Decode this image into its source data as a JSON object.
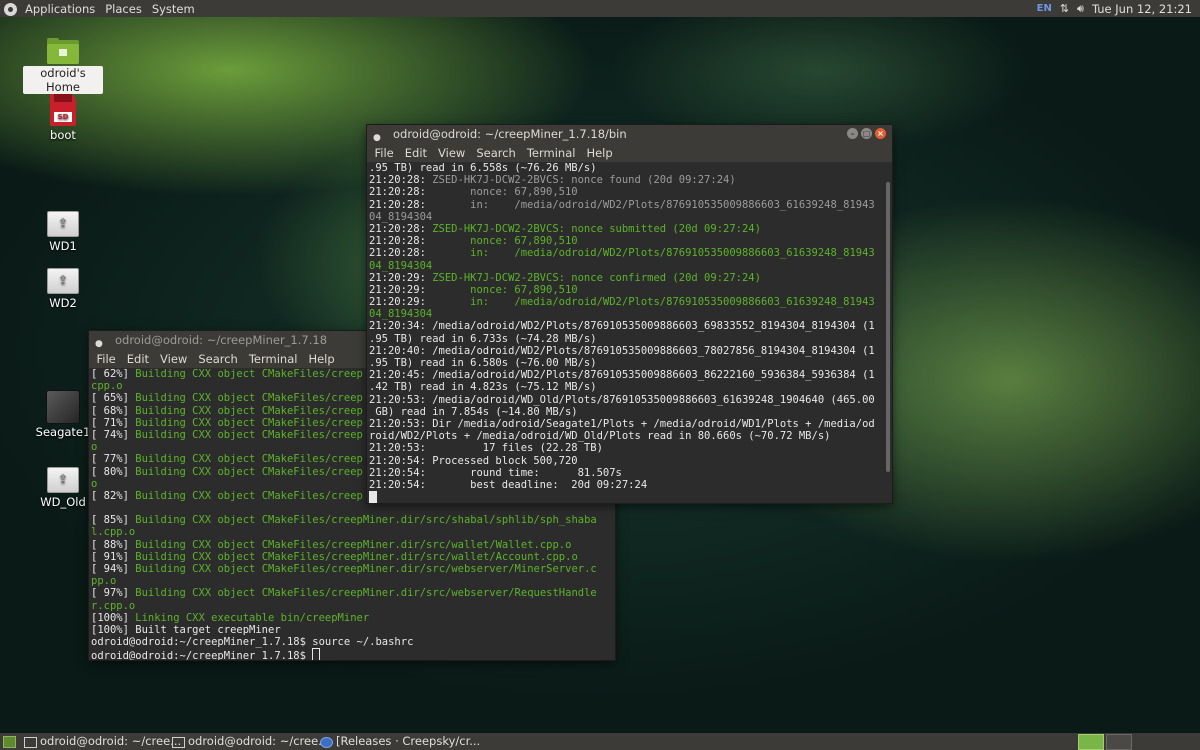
{
  "top_panel": {
    "menus": [
      "Applications",
      "Places",
      "System"
    ],
    "keyboard_indicator": "EN",
    "network_icon": "network-arrows-icon",
    "volume_icon": "speaker-icon",
    "clock": "Tue Jun 12, 21:21"
  },
  "desktop": {
    "icons": [
      {
        "label": "odroid's Home",
        "icon": "home-folder-icon"
      },
      {
        "label": "boot",
        "icon": "sd-card-icon"
      },
      {
        "label": "WD1",
        "icon": "usb-drive-icon"
      },
      {
        "label": "WD2",
        "icon": "usb-drive-icon"
      },
      {
        "label": "Seagate1",
        "icon": "hard-drive-icon"
      },
      {
        "label": "WD_Old",
        "icon": "usb-drive-icon"
      }
    ]
  },
  "terminal_build": {
    "title": "odroid@odroid: ~/creepMiner_1.7.18",
    "menu": [
      "File",
      "Edit",
      "View",
      "Search",
      "Terminal",
      "Help"
    ],
    "lines": [
      [
        {
          "t": "[ 62%] ",
          "c": ""
        },
        {
          "t": "Building CXX object CMakeFiles/creep",
          "c": "g"
        }
      ],
      [
        {
          "t": "cpp.o",
          "c": "g"
        }
      ],
      [
        {
          "t": "[ 65%] ",
          "c": ""
        },
        {
          "t": "Building CXX object CMakeFiles/creep",
          "c": "g"
        }
      ],
      [
        {
          "t": "[ 68%] ",
          "c": ""
        },
        {
          "t": "Building CXX object CMakeFiles/creep",
          "c": "g"
        }
      ],
      [
        {
          "t": "[ 71%] ",
          "c": ""
        },
        {
          "t": "Building CXX object CMakeFiles/creep",
          "c": "g"
        }
      ],
      [
        {
          "t": "[ 74%] ",
          "c": ""
        },
        {
          "t": "Building CXX object CMakeFiles/creep",
          "c": "g"
        }
      ],
      [
        {
          "t": "o",
          "c": "g"
        }
      ],
      [
        {
          "t": "[ 77%] ",
          "c": ""
        },
        {
          "t": "Building CXX object CMakeFiles/creep",
          "c": "g"
        }
      ],
      [
        {
          "t": "[ 80%] ",
          "c": ""
        },
        {
          "t": "Building CXX object CMakeFiles/creep",
          "c": "g"
        }
      ],
      [
        {
          "t": "o",
          "c": "g"
        }
      ],
      [
        {
          "t": "[ 82%] ",
          "c": ""
        },
        {
          "t": "Building CXX object CMakeFiles/creep",
          "c": "g"
        }
      ],
      [
        {
          "t": "",
          "c": ""
        }
      ],
      [
        {
          "t": "[ 85%] ",
          "c": ""
        },
        {
          "t": "Building CXX object CMakeFiles/creepMiner.dir/src/shabal/sphlib/sph_shaba",
          "c": "g"
        }
      ],
      [
        {
          "t": "l.cpp.o",
          "c": "g"
        }
      ],
      [
        {
          "t": "[ 88%] ",
          "c": ""
        },
        {
          "t": "Building CXX object CMakeFiles/creepMiner.dir/src/wallet/Wallet.cpp.o",
          "c": "g"
        }
      ],
      [
        {
          "t": "[ 91%] ",
          "c": ""
        },
        {
          "t": "Building CXX object CMakeFiles/creepMiner.dir/src/wallet/Account.cpp.o",
          "c": "g"
        }
      ],
      [
        {
          "t": "[ 94%] ",
          "c": ""
        },
        {
          "t": "Building CXX object CMakeFiles/creepMiner.dir/src/webserver/MinerServer.c",
          "c": "g"
        }
      ],
      [
        {
          "t": "pp.o",
          "c": "g"
        }
      ],
      [
        {
          "t": "[ 97%] ",
          "c": ""
        },
        {
          "t": "Building CXX object CMakeFiles/creepMiner.dir/src/webserver/RequestHandle",
          "c": "g"
        }
      ],
      [
        {
          "t": "r.cpp.o",
          "c": "g"
        }
      ],
      [
        {
          "t": "[100%] ",
          "c": ""
        },
        {
          "t": "Linking CXX executable bin/creepMiner",
          "c": "g"
        }
      ],
      [
        {
          "t": "[100%] Built target creepMiner",
          "c": ""
        }
      ],
      [
        {
          "t": "odroid@odroid:~/creepMiner_1.7.18$ source ~/.bashrc",
          "c": ""
        }
      ],
      [
        {
          "t": "odroid@odroid:~/creepMiner_1.7.18$ ",
          "c": ""
        }
      ]
    ]
  },
  "terminal_miner": {
    "title": "odroid@odroid: ~/creepMiner_1.7.18/bin",
    "menu": [
      "File",
      "Edit",
      "View",
      "Search",
      "Terminal",
      "Help"
    ],
    "lines": [
      [
        {
          "t": ".95 TB) read in 6.558s (~76.26 MB/s)",
          "c": ""
        }
      ],
      [
        {
          "t": "21:20:28: ",
          "c": ""
        },
        {
          "t": "ZSED-HK7J-DCW2-2BVCS: nonce found (20d 09:27:24)",
          "c": "gy"
        }
      ],
      [
        {
          "t": "21:20:28:       ",
          "c": ""
        },
        {
          "t": "nonce: 67,890,510",
          "c": "gy"
        }
      ],
      [
        {
          "t": "21:20:28:       ",
          "c": ""
        },
        {
          "t": "in:    /media/odroid/WD2/Plots/876910535009886603_61639248_81943",
          "c": "gy"
        }
      ],
      [
        {
          "t": "04_8194304",
          "c": "gy"
        }
      ],
      [
        {
          "t": "21:20:28: ",
          "c": ""
        },
        {
          "t": "ZSED-HK7J-DCW2-2BVCS: nonce submitted (20d 09:27:24)",
          "c": "g"
        }
      ],
      [
        {
          "t": "21:20:28:       ",
          "c": ""
        },
        {
          "t": "nonce: 67,890,510",
          "c": "g"
        }
      ],
      [
        {
          "t": "21:20:28:       ",
          "c": ""
        },
        {
          "t": "in:    /media/odroid/WD2/Plots/876910535009886603_61639248_81943",
          "c": "g"
        }
      ],
      [
        {
          "t": "04_8194304",
          "c": "g"
        }
      ],
      [
        {
          "t": "21:20:29: ",
          "c": ""
        },
        {
          "t": "ZSED-HK7J-DCW2-2BVCS: nonce confirmed (20d 09:27:24)",
          "c": "g"
        }
      ],
      [
        {
          "t": "21:20:29:       ",
          "c": ""
        },
        {
          "t": "nonce: 67,890,510",
          "c": "g"
        }
      ],
      [
        {
          "t": "21:20:29:       ",
          "c": ""
        },
        {
          "t": "in:    /media/odroid/WD2/Plots/876910535009886603_61639248_81943",
          "c": "g"
        }
      ],
      [
        {
          "t": "04_8194304",
          "c": "g"
        }
      ],
      [
        {
          "t": "21:20:34: /media/odroid/WD2/Plots/876910535009886603_69833552_8194304_8194304 (1",
          "c": ""
        }
      ],
      [
        {
          "t": ".95 TB) read in 6.733s (~74.28 MB/s)",
          "c": ""
        }
      ],
      [
        {
          "t": "21:20:40: /media/odroid/WD2/Plots/876910535009886603_78027856_8194304_8194304 (1",
          "c": ""
        }
      ],
      [
        {
          "t": ".95 TB) read in 6.580s (~76.00 MB/s)",
          "c": ""
        }
      ],
      [
        {
          "t": "21:20:45: /media/odroid/WD2/Plots/876910535009886603_86222160_5936384_5936384 (1",
          "c": ""
        }
      ],
      [
        {
          "t": ".42 TB) read in 4.823s (~75.12 MB/s)",
          "c": ""
        }
      ],
      [
        {
          "t": "21:20:53: /media/odroid/WD_Old/Plots/876910535009886603_61639248_1904640 (465.00",
          "c": ""
        }
      ],
      [
        {
          "t": " GB) read in 7.854s (~14.80 MB/s)",
          "c": ""
        }
      ],
      [
        {
          "t": "21:20:53: Dir /media/odroid/Seagate1/Plots + /media/odroid/WD1/Plots + /media/od",
          "c": ""
        }
      ],
      [
        {
          "t": "roid/WD2/Plots + /media/odroid/WD_Old/Plots read in 80.660s (~70.72 MB/s)",
          "c": ""
        }
      ],
      [
        {
          "t": "21:20:53:         17 files (22.28 TB)",
          "c": ""
        }
      ],
      [
        {
          "t": "21:20:54: Processed block 500,720",
          "c": ""
        }
      ],
      [
        {
          "t": "21:20:54:       round time:      81.507s",
          "c": ""
        }
      ],
      [
        {
          "t": "21:20:54:       best deadline:  20d 09:27:24",
          "c": ""
        }
      ],
      [
        {
          "t": "",
          "c": ""
        }
      ]
    ]
  },
  "taskbar": {
    "tasks": [
      {
        "label": "odroid@odroid: ~/cree...",
        "icon": "terminal-icon"
      },
      {
        "label": "odroid@odroid: ~/cree...",
        "icon": "terminal-icon"
      },
      {
        "label": "[Releases · Creepsky/cr...",
        "icon": "browser-icon"
      }
    ]
  },
  "colors": {
    "panel": "#3c3b37",
    "terminal_bg": "#2c2c2c",
    "green_text": "#5cb32a",
    "accent": "#7ab547"
  }
}
